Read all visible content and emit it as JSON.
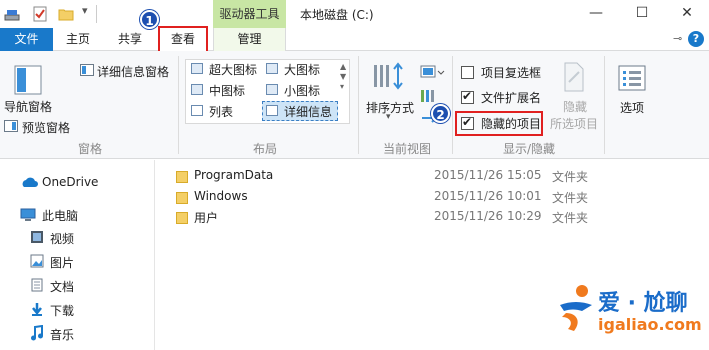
{
  "titlebar": {
    "context_tab": "驱动器工具",
    "window_title": "本地磁盘 (C:)",
    "minimize": "—",
    "maximize": "☐",
    "close": "✕"
  },
  "tabs": {
    "file": "文件",
    "home": "主页",
    "share": "共享",
    "view": "查看",
    "manage": "管理"
  },
  "ribbon": {
    "panes": {
      "nav_pane": "导航窗格",
      "preview_pane": "预览窗格",
      "details_pane": "详细信息窗格",
      "group_label": "窗格"
    },
    "layout": {
      "items": [
        "超大图标",
        "大图标",
        "中图标",
        "小图标",
        "列表",
        "详细信息"
      ],
      "group_label": "布局"
    },
    "current_view": {
      "sort_by": "排序方式",
      "group_label": "当前视图"
    },
    "show_hide": {
      "item_checkboxes": "项目复选框",
      "file_extensions": "文件扩展名",
      "hidden_items": "隐藏的项目",
      "hide_selected_1": "隐藏",
      "hide_selected_2": "所选项目",
      "group_label": "显示/隐藏"
    },
    "options": "选项",
    "checkbox_states": {
      "item_checkboxes": false,
      "file_extensions": true,
      "hidden_items": true
    }
  },
  "nav": {
    "items": [
      "OneDrive",
      "此电脑",
      "视频",
      "图片",
      "文档",
      "下载",
      "音乐"
    ]
  },
  "files": [
    {
      "name": "ProgramData",
      "date": "2015/11/26 15:05",
      "type": "文件夹"
    },
    {
      "name": "Windows",
      "date": "2015/11/26 10:01",
      "type": "文件夹"
    },
    {
      "name": "用户",
      "date": "2015/11/26 10:29",
      "type": "文件夹"
    }
  ],
  "badges": {
    "one": "1",
    "two": "2"
  },
  "watermark": {
    "title": "爱 · 尬聊",
    "url": "igaliao.com"
  },
  "colors": {
    "accent": "#1979ca",
    "highlight": "#e0201f",
    "badge": "#1d4fb0",
    "context_tab": "#c8e6a4"
  }
}
